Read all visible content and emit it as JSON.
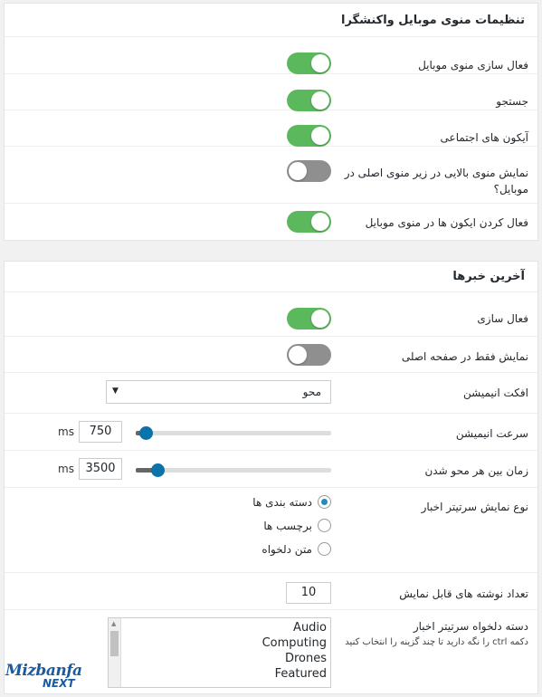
{
  "section1": {
    "title": "تنظیمات منوی موبایل واکنشگرا",
    "rows": [
      {
        "label": "فعال سازی منوی موبایل",
        "toggle": true
      },
      {
        "label": "جستجو",
        "toggle": true
      },
      {
        "label": "آیکون های اجتماعی",
        "toggle": true
      },
      {
        "label": "نمایش منوی بالایی در زیر منوی اصلی در موبایل؟",
        "toggle": false
      },
      {
        "label": "فعال کردن ایکون ها در منوی موبایل",
        "toggle": true
      }
    ]
  },
  "section2": {
    "title": "آخرین خبرها",
    "enable": {
      "label": "فعال سازی",
      "toggle": true
    },
    "homepage_only": {
      "label": "نمایش فقط در صفحه اصلی",
      "toggle": false
    },
    "animation_effect": {
      "label": "افکت انیمیشن",
      "value": "محو"
    },
    "animation_speed": {
      "label": "سرعت انیمیشن",
      "value": "750",
      "unit": "ms",
      "level": 0.05
    },
    "fade_interval": {
      "label": "زمان بین هر محو شدن",
      "value": "3500",
      "unit": "ms",
      "level": 0.11
    },
    "title_type": {
      "label": "نوع نمایش سرتیتر اخبار",
      "options": [
        {
          "label": "دسته بندی ها",
          "checked": true
        },
        {
          "label": "برچسب ها",
          "checked": false
        },
        {
          "label": "متن دلخواه",
          "checked": false
        }
      ]
    },
    "post_count": {
      "label": "تعداد نوشته های قابل نمایش",
      "value": "10"
    },
    "custom_categories": {
      "label": "دسته دلخواه سرتیتر اخبار",
      "help": "دکمه ctrl را نگه دارید تا چند گزینه را انتخاب کنید",
      "items": [
        "Audio",
        "Computing",
        "Drones",
        "Featured"
      ]
    }
  },
  "logo": {
    "line1": "Mizbanfa",
    "line2": "NEXT",
    "color": "#1a5aa0"
  },
  "colors": {
    "toggle_on": "#5cb85c",
    "toggle_off": "#8f8f8f",
    "slider_thumb": "#0a73aa",
    "radio": "#1e8cbe"
  }
}
